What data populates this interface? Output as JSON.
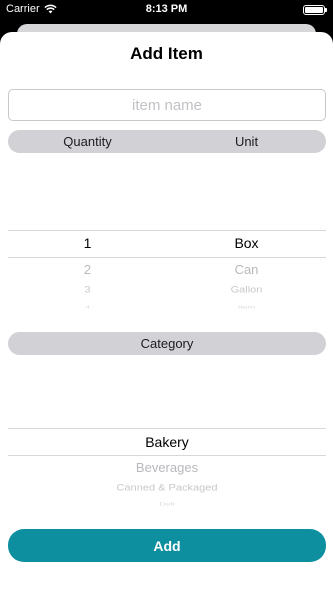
{
  "status_bar": {
    "carrier": "Carrier",
    "time": "8:13 PM",
    "battery_level": 1.0
  },
  "title": "Add Item",
  "name_input": {
    "placeholder": "item name",
    "value": ""
  },
  "quantity_unit_header": {
    "quantity": "Quantity",
    "unit": "Unit"
  },
  "quantity_picker": {
    "selected": "1",
    "below": [
      "2",
      "3",
      "4"
    ]
  },
  "unit_picker": {
    "selected": "Box",
    "below": [
      "Can",
      "Gallon",
      "Item"
    ]
  },
  "category_header": "Category",
  "category_picker": {
    "selected": "Bakery",
    "below": [
      "Beverages",
      "Canned & Packaged",
      "Deli"
    ]
  },
  "add_button": "Add"
}
